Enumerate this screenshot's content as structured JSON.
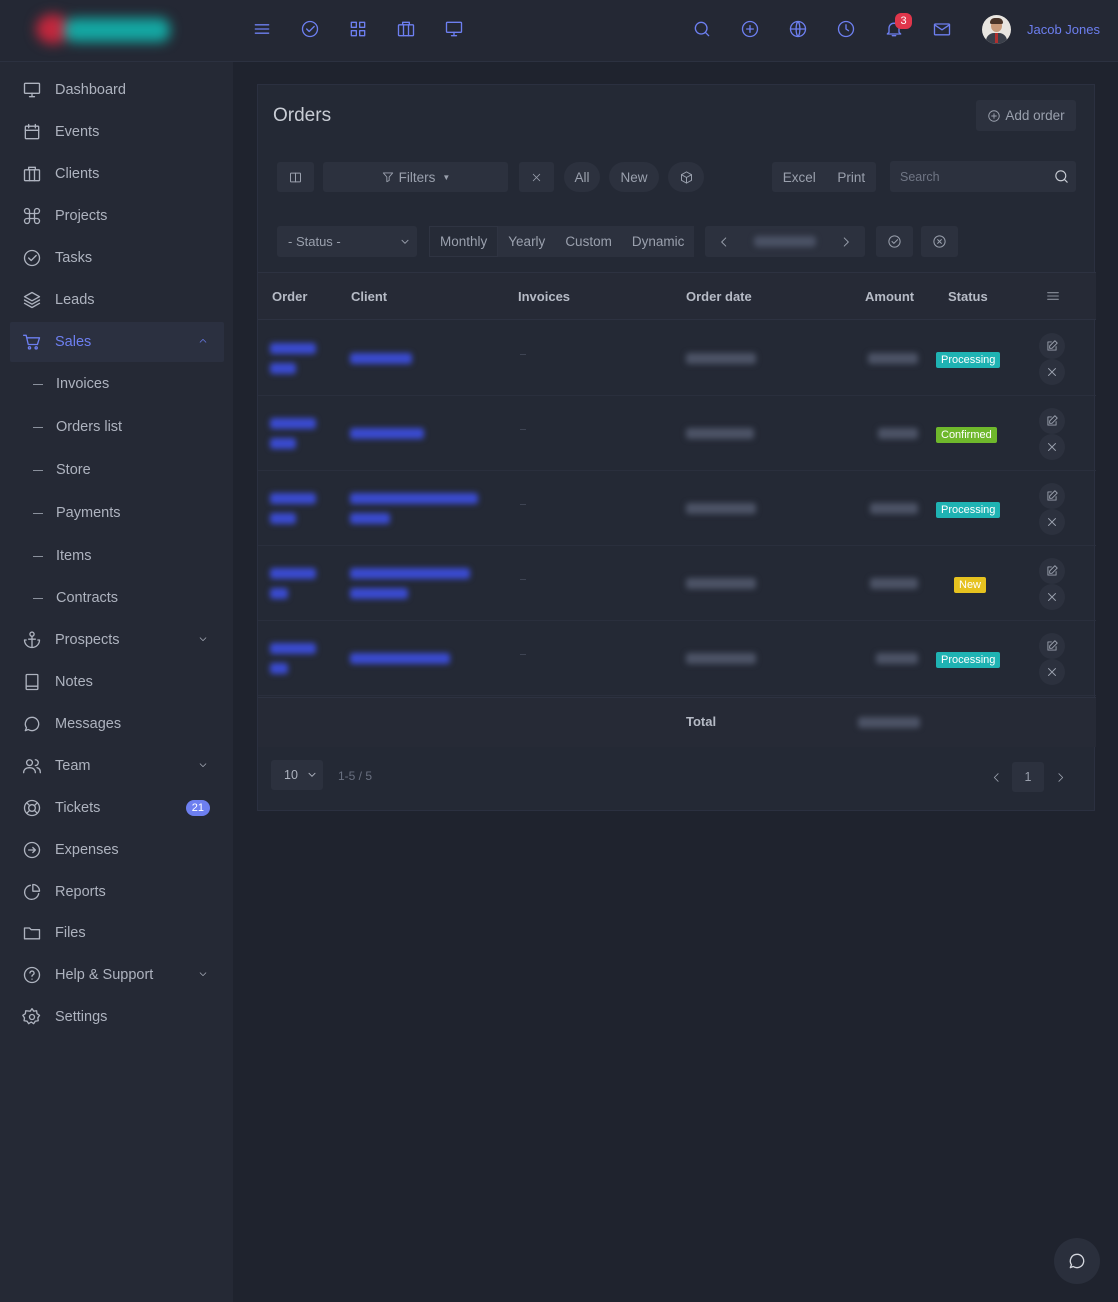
{
  "colors": {
    "accent": "#6d7ff0",
    "processing": "#1fb3b3",
    "confirmed": "#6fb82c",
    "new": "#e6c21f",
    "danger": "#e0364b"
  },
  "topbar": {
    "notifications_count": "3",
    "user_name": "Jacob Jones",
    "left_icons": [
      "menu-icon",
      "check-circle-icon",
      "grid-icon",
      "briefcase-icon",
      "monitor-icon"
    ],
    "right_icons": [
      "search-icon",
      "plus-circle-icon",
      "globe-icon",
      "clock-icon",
      "bell-icon",
      "mail-icon"
    ]
  },
  "sidebar": {
    "items": [
      {
        "label": "Dashboard",
        "icon": "monitor-icon"
      },
      {
        "label": "Events",
        "icon": "calendar-icon"
      },
      {
        "label": "Clients",
        "icon": "briefcase-icon"
      },
      {
        "label": "Projects",
        "icon": "command-icon"
      },
      {
        "label": "Tasks",
        "icon": "check-circle-icon"
      },
      {
        "label": "Leads",
        "icon": "layers-icon"
      },
      {
        "label": "Sales",
        "icon": "cart-icon"
      },
      {
        "label": "Invoices"
      },
      {
        "label": "Orders list"
      },
      {
        "label": "Store"
      },
      {
        "label": "Payments"
      },
      {
        "label": "Items"
      },
      {
        "label": "Contracts"
      },
      {
        "label": "Prospects",
        "icon": "anchor-icon"
      },
      {
        "label": "Notes",
        "icon": "book-icon"
      },
      {
        "label": "Messages",
        "icon": "message-icon"
      },
      {
        "label": "Team",
        "icon": "users-icon"
      },
      {
        "label": "Tickets",
        "icon": "lifebuoy-icon",
        "badge": "21"
      },
      {
        "label": "Expenses",
        "icon": "arrow-circle-icon"
      },
      {
        "label": "Reports",
        "icon": "pie-chart-icon"
      },
      {
        "label": "Files",
        "icon": "folder-icon"
      },
      {
        "label": "Help & Support",
        "icon": "help-circle-icon"
      },
      {
        "label": "Settings",
        "icon": "settings-icon"
      }
    ]
  },
  "orders": {
    "title": "Orders",
    "add_button": "Add order",
    "filters_label": "Filters",
    "filter_all": "All",
    "filter_new": "New",
    "excel": "Excel",
    "print": "Print",
    "search_placeholder": "Search",
    "status_select": "- Status -",
    "ranges": [
      "Monthly",
      "Yearly",
      "Custom",
      "Dynamic"
    ],
    "columns": [
      "Order",
      "Client",
      "Invoices",
      "Order date",
      "Amount",
      "Status"
    ],
    "rows": [
      {
        "status": "Processing",
        "invoices": "-"
      },
      {
        "status": "Confirmed",
        "invoices": "-"
      },
      {
        "status": "Processing",
        "invoices": "-"
      },
      {
        "status": "New",
        "invoices": "-"
      },
      {
        "status": "Processing",
        "invoices": "-"
      }
    ],
    "total_label": "Total",
    "page_size": "10",
    "count_text": "1-5 / 5",
    "current_page": "1"
  }
}
